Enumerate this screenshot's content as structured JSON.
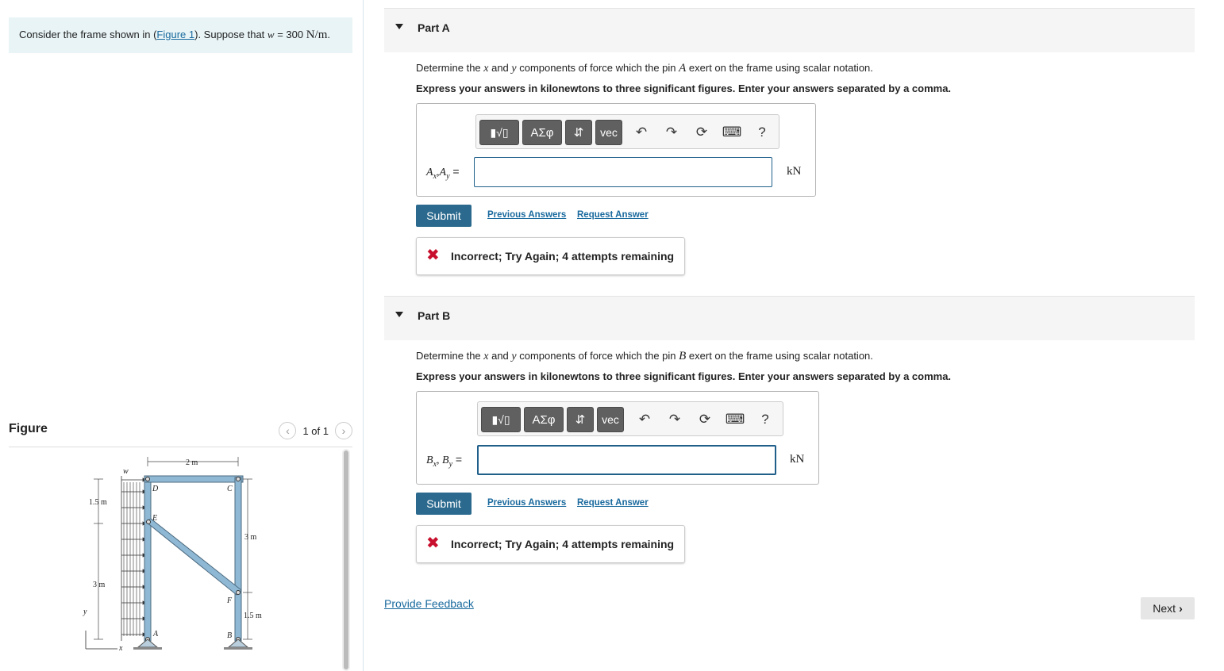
{
  "problem": {
    "prefix": "Consider the frame shown in (",
    "figure_link": "Figure 1",
    "suffix": "). Suppose that ",
    "var": "w",
    "value": " = 300 ",
    "unit": "N/m",
    "end": "."
  },
  "figure": {
    "title": "Figure",
    "pager": "1 of 1",
    "labels": {
      "w": "w",
      "dim_top": "2 m",
      "dim_15_left": "1.5 m",
      "dim_3_left": "3 m",
      "dim_3_right": "3 m",
      "dim_15_right": "1.5 m",
      "D": "D",
      "C": "C",
      "E": "E",
      "F": "F",
      "A": "A",
      "B": "B",
      "x": "x",
      "y": "y"
    }
  },
  "parts": [
    {
      "title": "Part A",
      "q_pre": "Determine the ",
      "q_x": "x",
      "q_and": " and ",
      "q_y": "y",
      "q_mid": " components of force which the pin ",
      "q_pin": "A",
      "q_post": " exert on the frame using scalar notation.",
      "instructions": "Express your answers in kilonewtons to three significant figures. Enter your answers separated by a comma.",
      "answer_label_1": "A",
      "answer_sub_1": "x",
      "answer_sep": ",",
      "answer_label_2": "A",
      "answer_sub_2": "y",
      "answer_eq": " =",
      "input_value": "",
      "unit": "kN",
      "submit": "Submit",
      "previous_answers": "Previous Answers",
      "request_answer": "Request Answer",
      "feedback": "Incorrect; Try Again; 4 attempts remaining"
    },
    {
      "title": "Part B",
      "q_pre": "Determine the ",
      "q_x": "x",
      "q_and": " and ",
      "q_y": "y",
      "q_mid": " components of force which the pin ",
      "q_pin": "B",
      "q_post": " exert on the frame using scalar notation.",
      "instructions": "Express your answers in kilonewtons to three significant figures. Enter your answers separated by a comma.",
      "answer_label_1": "B",
      "answer_sub_1": "x",
      "answer_sep": ", ",
      "answer_label_2": "B",
      "answer_sub_2": "y",
      "answer_eq": " =",
      "input_value": "",
      "unit": "kN",
      "submit": "Submit",
      "previous_answers": "Previous Answers",
      "request_answer": "Request Answer",
      "feedback": "Incorrect; Try Again; 4 attempts remaining"
    }
  ],
  "toolbar": {
    "templates": "▮√▯",
    "greek": "ΑΣφ",
    "arrows": "⇵",
    "vec": "vec",
    "undo": "↶",
    "redo": "↷",
    "reset": "⟳",
    "keyboard": "⌨",
    "help": "?"
  },
  "footer": {
    "provide_feedback": "Provide Feedback",
    "next": "Next"
  },
  "colors": {
    "accent": "#2b6a8e",
    "link": "#1a6a9e",
    "error": "#c8102e",
    "problem_bg": "#e8f4f6",
    "member": "#8fb8d4"
  }
}
